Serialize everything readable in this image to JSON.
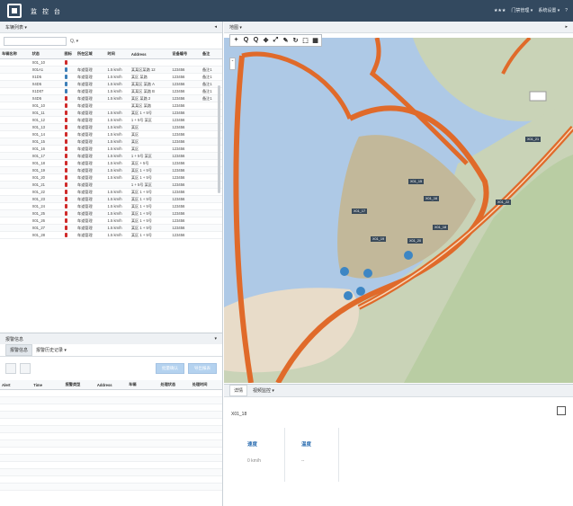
{
  "topbar": {
    "app_name": "监 控 台",
    "right_items": [
      "★★★",
      "门禁管理 ▾",
      "系统设置 ▾",
      "?"
    ]
  },
  "left": {
    "title": "车辆列表 ▾",
    "search_placeholder": "",
    "filter_label": "Q, ▾",
    "columns": [
      "车辆名称",
      "状态",
      "图标",
      "所在区域",
      "时间",
      "Address",
      "设备编号",
      "备注"
    ],
    "rows": [
      [
        "",
        "X01_10",
        "",
        "",
        "",
        "",
        "",
        ""
      ],
      [
        "",
        "X01A1",
        "",
        "车道管理",
        "1.5 km/h",
        "某某区某路 12",
        "123456",
        "备注1"
      ],
      [
        "",
        "X1D5",
        "",
        "车道管理",
        "1.5 km/h",
        "某区 某路",
        "123456",
        "备注1"
      ],
      [
        "",
        "X4D5",
        "",
        "车道管理",
        "1.5 km/h",
        "某某区 某路 A",
        "123456",
        "备注1"
      ],
      [
        "",
        "X1D07",
        "",
        "车道管理",
        "1.5 km/h",
        "某某区 某路 B",
        "123456",
        "备注1"
      ],
      [
        "",
        "X4D5",
        "",
        "车道管理",
        "1.5 km/h",
        "某区 某路 2",
        "123456",
        "备注1"
      ],
      [
        "",
        "X01_10",
        "",
        "车道管理",
        "",
        "某某区 某路",
        "123456",
        ""
      ],
      [
        "",
        "X01_11",
        "",
        "车道管理",
        "1.5 km/h",
        "某区 1 + 5号",
        "123456",
        ""
      ],
      [
        "",
        "X01_12",
        "",
        "车道管理",
        "1.5 km/h",
        "1 + 5号 某区",
        "123456",
        ""
      ],
      [
        "",
        "X01_13",
        "",
        "车道管理",
        "1.5 km/h",
        "某区",
        "123456",
        ""
      ],
      [
        "",
        "X01_14",
        "",
        "车道管理",
        "1.5 km/h",
        "某区",
        "123456",
        ""
      ],
      [
        "",
        "X01_15",
        "",
        "车道管理",
        "1.5 km/h",
        "某区",
        "123456",
        ""
      ],
      [
        "",
        "X01_16",
        "",
        "车道管理",
        "1.5 km/h",
        "某区",
        "123456",
        ""
      ],
      [
        "",
        "X01_17",
        "",
        "车道管理",
        "1.5 km/h",
        "1 + 5号 某区",
        "123456",
        ""
      ],
      [
        "",
        "X01_18",
        "",
        "车道管理",
        "1.5 km/h",
        "某区 + 5号",
        "123456",
        ""
      ],
      [
        "",
        "X01_19",
        "",
        "车道管理",
        "1.5 km/h",
        "某区 1 + 5号",
        "123456",
        ""
      ],
      [
        "",
        "X01_20",
        "",
        "车道管理",
        "1.5 km/h",
        "某区 1 + 5号",
        "123456",
        ""
      ],
      [
        "",
        "X01_21",
        "",
        "车道管理",
        "",
        "1 + 5号 某区",
        "123456",
        ""
      ],
      [
        "",
        "X01_22",
        "",
        "车道管理",
        "1.5 km/h",
        "某区 1 + 5号",
        "123456",
        ""
      ],
      [
        "",
        "X01_23",
        "",
        "车道管理",
        "1.5 km/h",
        "某区 1 + 5号",
        "123456",
        ""
      ],
      [
        "",
        "X01_24",
        "",
        "车道管理",
        "1.5 km/h",
        "某区 1 + 5号",
        "123456",
        ""
      ],
      [
        "",
        "X01_25",
        "",
        "车道管理",
        "1.5 km/h",
        "某区 1 + 5号",
        "123456",
        ""
      ],
      [
        "",
        "X01_26",
        "",
        "车道管理",
        "1.5 km/h",
        "某区 1 + 5号",
        "123456",
        ""
      ],
      [
        "",
        "X01_27",
        "",
        "车道管理",
        "1.5 km/h",
        "某区 1 + 5号",
        "123456",
        ""
      ],
      [
        "",
        "X01_28",
        "",
        "车道管理",
        "1.5 km/h",
        "某区 1 + 5号",
        "123456",
        ""
      ]
    ],
    "pin_colors": [
      "red",
      "blue",
      "blue",
      "blue",
      "blue",
      "red",
      "red",
      "red",
      "red",
      "red",
      "red",
      "red",
      "red",
      "red",
      "red",
      "red",
      "red",
      "red",
      "red",
      "red",
      "red",
      "red",
      "red",
      "red",
      "red"
    ]
  },
  "lower": {
    "title": "报警信息",
    "tabs": [
      "报警信息",
      "报警历史记录 ▾"
    ],
    "btn_confirm": "批量确认",
    "btn_export": "导出报表",
    "columns": [
      "Alert",
      "Time",
      "报警类型",
      "Address",
      "车辆",
      "处理状态",
      "处理时间"
    ]
  },
  "map": {
    "title": "地图 ▾",
    "tools": [
      "+",
      "Q",
      "Q",
      "✥",
      "⤢",
      "✎",
      "↻",
      "⬚",
      "▦"
    ],
    "zoom": "-",
    "labels": [
      "X01_15",
      "X01_16",
      "X01_17",
      "X01_18",
      "X01_19",
      "X01_20",
      "X01_21",
      "X01_22"
    ],
    "colors": {
      "water": "#aec9e6",
      "land": "#c9d3b7",
      "island": "#c2b89a",
      "road": "#e06a2a"
    }
  },
  "detail": {
    "tabs": [
      "详情",
      "视频监控 ▾"
    ],
    "vehicle": "X01_18",
    "cards": [
      {
        "k": "速度",
        "v": "0 km/h"
      },
      {
        "k": "温度",
        "v": "--"
      }
    ]
  }
}
